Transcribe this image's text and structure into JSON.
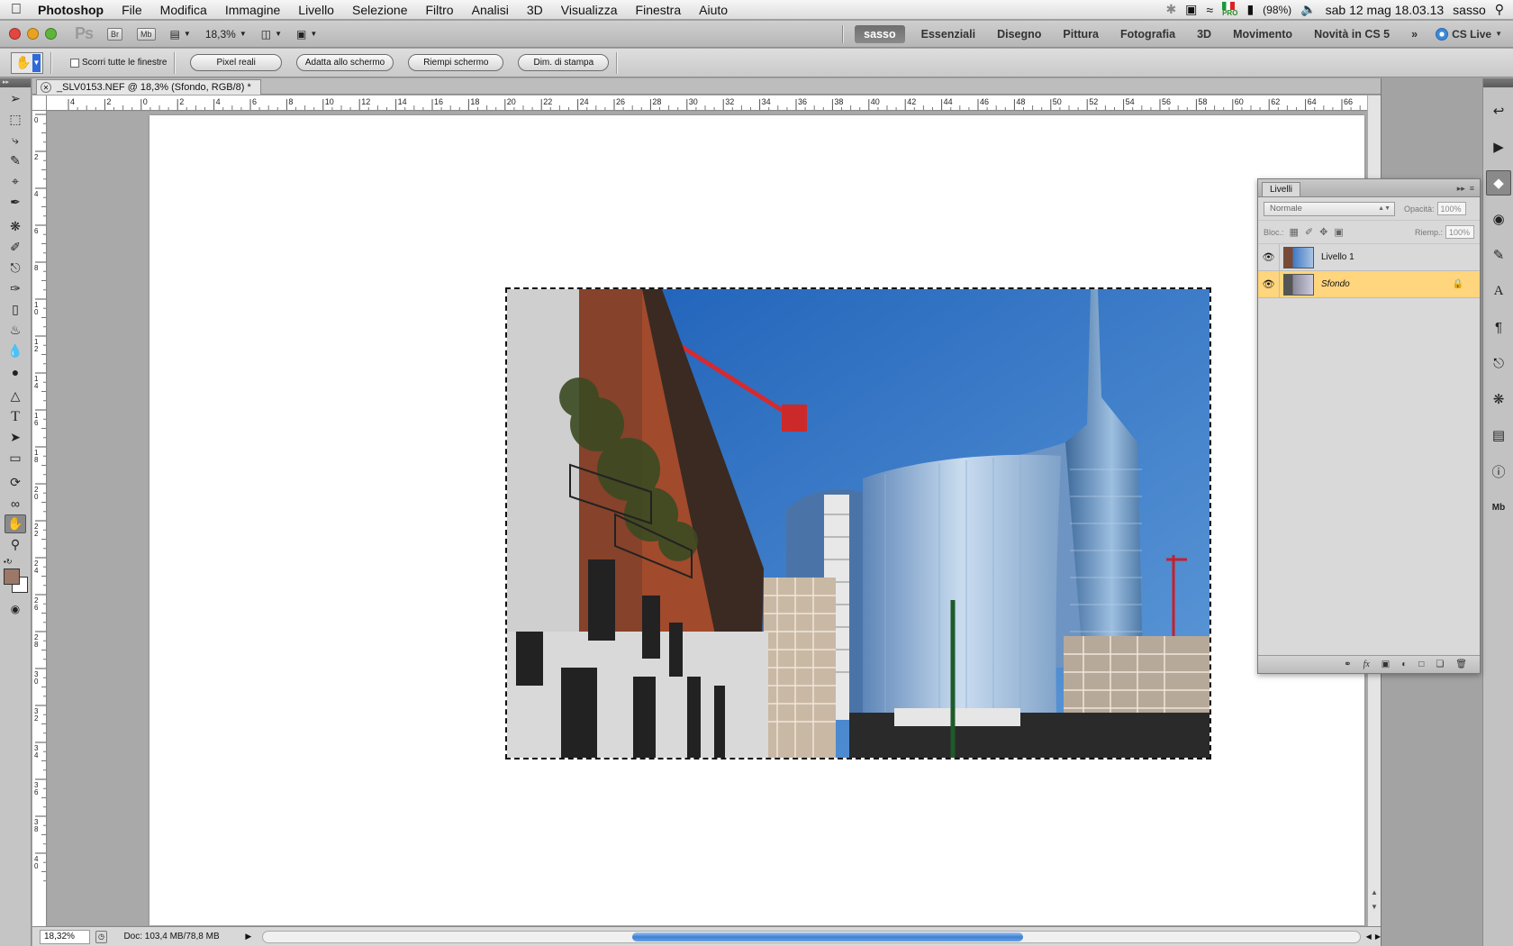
{
  "menubar": {
    "app_name": "Photoshop",
    "items": [
      "File",
      "Modifica",
      "Immagine",
      "Livello",
      "Selezione",
      "Filtro",
      "Analisi",
      "3D",
      "Visualizza",
      "Finestra",
      "Aiuto"
    ],
    "flag_label": "PRO",
    "battery": "(98%)",
    "clock": "sab 12 mag  18.03.13",
    "user": "sasso"
  },
  "appbar": {
    "logo": "Ps",
    "bridge_label": "Br",
    "minibridge_label": "Mb",
    "zoom": "18,3%",
    "workspaces": [
      "Essenziali",
      "Disegno",
      "Pittura",
      "Fotografia",
      "3D",
      "Movimento",
      "Novità in CS 5"
    ],
    "active_workspace": "sasso",
    "cs_live": "CS Live"
  },
  "options": {
    "scroll_all_label": "Scorri tutte le finestre",
    "buttons": [
      "Pixel reali",
      "Adatta allo schermo",
      "Riempi schermo",
      "Dim. di stampa"
    ]
  },
  "document": {
    "tab_title": "_SLV0153.NEF @ 18,3% (Sfondo, RGB/8) *",
    "ruler_top_labels": [
      "4",
      "2",
      "0",
      "2",
      "4",
      "6",
      "8",
      "10",
      "12",
      "14",
      "16",
      "18",
      "20",
      "22",
      "24",
      "26",
      "28",
      "30",
      "32",
      "34",
      "36",
      "38",
      "40",
      "42",
      "44",
      "46",
      "48",
      "50",
      "52",
      "54",
      "56",
      "58",
      "60",
      "62",
      "64",
      "66"
    ],
    "ruler_left_labels": [
      "0",
      "2",
      "4",
      "6",
      "8",
      "10",
      "12",
      "14",
      "16",
      "18",
      "20",
      "22",
      "24",
      "26",
      "28",
      "30",
      "32",
      "34",
      "36",
      "38",
      "40"
    ]
  },
  "status": {
    "zoom": "18,32%",
    "doc_info": "Doc: 103,4 MB/78,8 MB"
  },
  "layers_panel": {
    "tab": "Livelli",
    "blend_mode": "Normale",
    "opacity_label": "Opacità:",
    "opacity_value": "100%",
    "lock_label": "Bloc.:",
    "fill_label": "Riemp.:",
    "fill_value": "100%",
    "layers": [
      {
        "name": "Livello 1",
        "selected": false
      },
      {
        "name": "Sfondo",
        "selected": true
      }
    ]
  },
  "colors": {
    "foreground": "#9c7868",
    "background": "#ffffff",
    "selection_highlight": "#ffd57d",
    "scroll_thumb": "#3c7fd2"
  }
}
